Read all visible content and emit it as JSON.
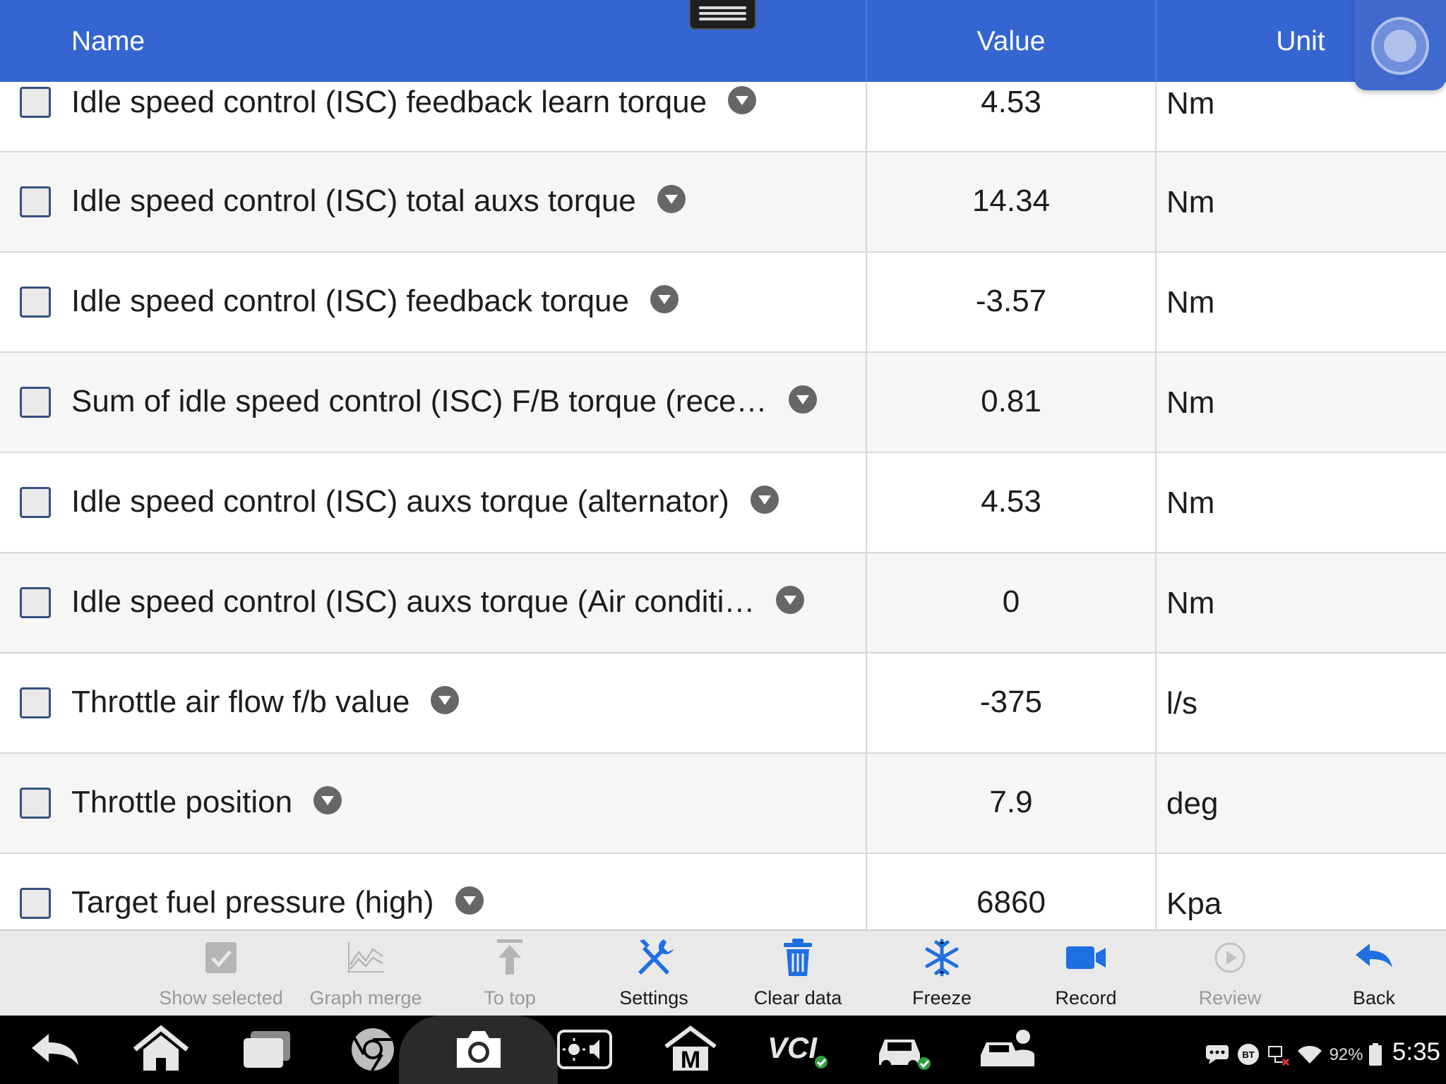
{
  "header": {
    "name": "Name",
    "value": "Value",
    "unit": "Unit"
  },
  "rows": [
    {
      "name": "Idle speed control (ISC) feedback learn torque",
      "value": "4.53",
      "unit": "Nm"
    },
    {
      "name": "Idle speed control (ISC) total auxs torque",
      "value": "14.34",
      "unit": "Nm"
    },
    {
      "name": "Idle speed control (ISC) feedback torque",
      "value": "-3.57",
      "unit": "Nm"
    },
    {
      "name": "Sum of idle speed control (ISC) F/B torque (rece…",
      "value": "0.81",
      "unit": "Nm"
    },
    {
      "name": "Idle speed control (ISC) auxs torque (alternator)",
      "value": "4.53",
      "unit": "Nm"
    },
    {
      "name": "Idle speed control (ISC) auxs torque (Air conditi…",
      "value": "0",
      "unit": "Nm"
    },
    {
      "name": "Throttle air flow f/b value",
      "value": "-375",
      "unit": "l/s"
    },
    {
      "name": "Throttle position",
      "value": "7.9",
      "unit": "deg"
    },
    {
      "name": "Target fuel pressure (high)",
      "value": "6860",
      "unit": "Kpa"
    }
  ],
  "toolbar": {
    "show_selected": "Show selected",
    "graph_merge": "Graph merge",
    "to_top": "To top",
    "settings": "Settings",
    "clear_data": "Clear data",
    "freeze": "Freeze",
    "record": "Record",
    "review": "Review",
    "back": "Back"
  },
  "status": {
    "battery": "92%",
    "time": "5:35",
    "bt": "BT"
  },
  "icons": {
    "sys_nav": [
      "back-icon",
      "home-icon",
      "recent-apps-icon",
      "chrome-icon",
      "camera-icon",
      "brightness-volume-icon",
      "maxifix-icon",
      "vci-icon",
      "car-check-icon",
      "car-service-icon"
    ],
    "status": [
      "chat-icon",
      "bluetooth-icon",
      "network-icon",
      "wifi-icon",
      "battery-icon"
    ]
  },
  "colors": {
    "header": "#3565d1",
    "accent": "#1f6fe0",
    "toolbar": "#e9e9e9"
  },
  "sys_labels": {
    "vci": "VCI",
    "maxifix": "M"
  }
}
